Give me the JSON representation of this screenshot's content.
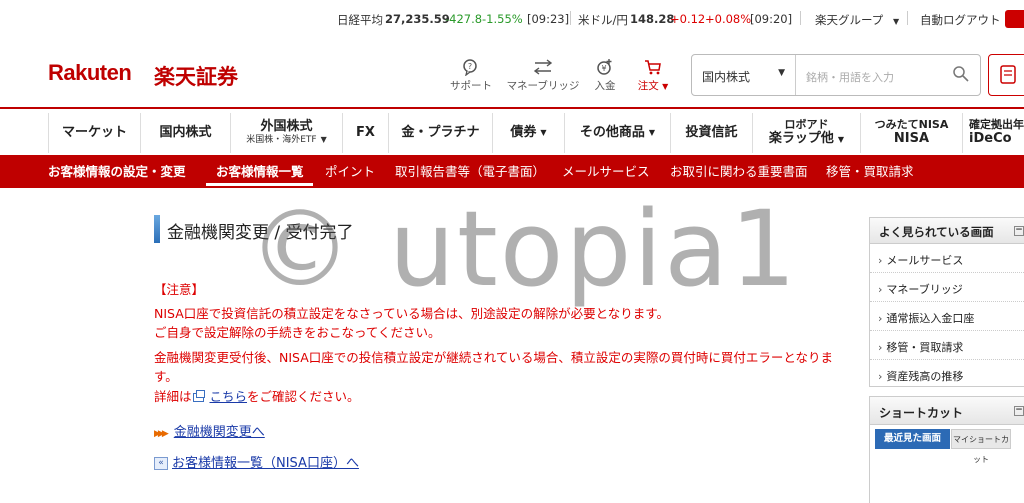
{
  "ticker": {
    "nikkei_label": "日経平均",
    "nikkei_value": "27,235.59",
    "nikkei_change": "-427.8",
    "nikkei_pct": "-1.55%",
    "nikkei_time": "[09:23]",
    "usdjpy_label": "米ドル/円",
    "usdjpy_value": "148.28",
    "usdjpy_change": "+0.12",
    "usdjpy_pct": "+0.08%",
    "usdjpy_time": "[09:20]",
    "group_label": "楽天グループ",
    "auto_logout_label": "自動ログアウト"
  },
  "header": {
    "logo_main": "Rakuten",
    "logo_sub": "楽天証券",
    "icons": [
      {
        "label": "サポート",
        "icon": "support-chat-icon"
      },
      {
        "label": "マネーブリッジ",
        "icon": "bank-transfer-icon"
      },
      {
        "label": "入金",
        "icon": "deposit-icon"
      },
      {
        "label": "注文",
        "icon": "cart-icon"
      }
    ],
    "order_caret": "▼",
    "search_category": "国内株式",
    "search_placeholder": "銘柄・用語を入力"
  },
  "gnav": {
    "items": [
      {
        "label": "マーケット"
      },
      {
        "label": "国内株式"
      },
      {
        "label": "外国株式",
        "sub": "米国株・海外ETF"
      },
      {
        "label": "FX"
      },
      {
        "label": "金・プラチナ"
      },
      {
        "label": "債券"
      },
      {
        "label": "その他商品"
      },
      {
        "label": "投資信託"
      },
      {
        "label": "ロボアド",
        "big": "楽ラップ他"
      },
      {
        "label": "つみたてNISA",
        "big": "NISA"
      },
      {
        "label": "確定拠出年金",
        "big": "iDeCo"
      }
    ]
  },
  "subnav": {
    "items": [
      "お客様情報の設定・変更",
      "お客様情報一覧",
      "ポイント",
      "取引報告書等（電子書面）",
      "メールサービス",
      "お取引に関わる重要書面",
      "移管・買取請求"
    ]
  },
  "main": {
    "title": "金融機関変更 / 受付完了",
    "notice_heading": "【注意】",
    "notice_lines": [
      "NISA口座で投資信託の積立設定をなさっている場合は、別途設定の解除が必要となります。",
      "ご自身で設定解除の手続きをおこなってください。",
      "金融機関変更受付後、NISA口座での投信積立設定が継続されている場合、積立設定の実際の買付時に買付エラーとなりま",
      "す。"
    ],
    "detail_prefix": "詳細は",
    "detail_link": "こちら",
    "detail_suffix": "をご確認ください。",
    "link_change": "金融機関変更へ",
    "link_back": "お客様情報一覧（NISA口座）へ",
    "watermark": "© utopia1"
  },
  "sidebar": {
    "popular_title": "よく見られている画面",
    "popular_items": [
      "メールサービス",
      "マネーブリッジ",
      "通常振込入金口座",
      "移管・買取請求",
      "資産残高の推移"
    ],
    "shortcut_title": "ショートカット",
    "tab_recent": "最近見た画面",
    "tab_my": "マイショートカット"
  }
}
